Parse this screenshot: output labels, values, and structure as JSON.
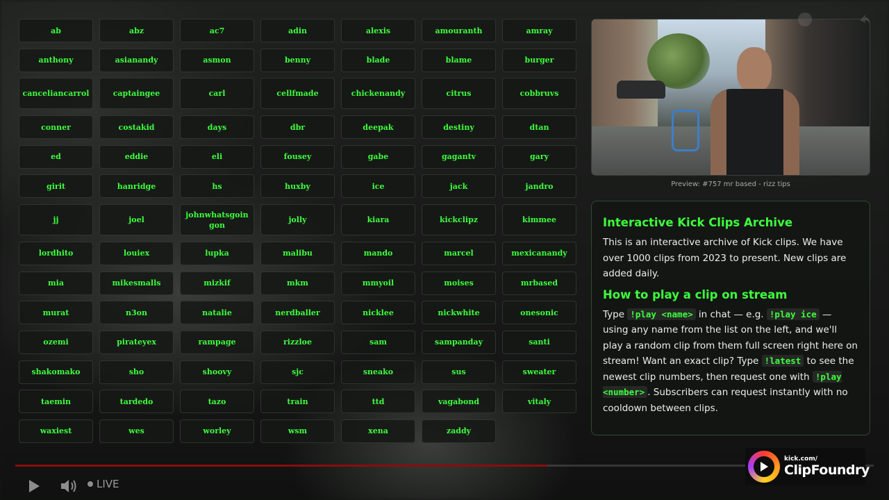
{
  "clip_names": [
    "ab",
    "abz",
    "ac7",
    "adin",
    "alexis",
    "amouranth",
    "amray",
    "anthony",
    "asianandy",
    "asmon",
    "benny",
    "blade",
    "blame",
    "burger",
    "canceliancarrol",
    "captaingee",
    "carl",
    "cellfmade",
    "chickenandy",
    "citrus",
    "cobbruvs",
    "conner",
    "costakid",
    "days",
    "dbr",
    "deepak",
    "destiny",
    "dtan",
    "ed",
    "eddie",
    "eli",
    "fousey",
    "gabe",
    "gagantv",
    "gary",
    "girit",
    "hanridge",
    "hs",
    "huxby",
    "ice",
    "jack",
    "jandro",
    "jj",
    "joel",
    "johnwhatsgoingon",
    "jolly",
    "kiara",
    "kickclipz",
    "kimmee",
    "lordhito",
    "louiex",
    "lupka",
    "malibu",
    "mando",
    "marcel",
    "mexicanandy",
    "mia",
    "mikesmalls",
    "mizkif",
    "mkm",
    "mmyoil",
    "moises",
    "mrbased",
    "murat",
    "n3on",
    "natalie",
    "nerdballer",
    "nicklee",
    "nickwhite",
    "onesonic",
    "ozemi",
    "pirateyex",
    "rampage",
    "rizzloe",
    "sam",
    "sampanday",
    "santi",
    "shakomako",
    "sho",
    "shoovy",
    "sjc",
    "sneako",
    "sus",
    "sweater",
    "taemin",
    "tardedo",
    "tazo",
    "train",
    "ttd",
    "vagabond",
    "vitaly",
    "waxiest",
    "wes",
    "worley",
    "wsm",
    "xena",
    "zaddy"
  ],
  "preview": {
    "caption": "Preview: #757 mr based - rizz tips"
  },
  "info": {
    "title": "Interactive Kick Clips Archive",
    "description": "This is an interactive archive of Kick clips. We have over 1000 clips from 2023 to present. New clips are added daily.",
    "howto_title": "How to play a clip on stream",
    "type_word": "Type ",
    "cmd_play_name": "!play <name>",
    "in_chat": " in chat — e.g. ",
    "cmd_play_ice": "!play ice",
    "howto_rest": " — using any name from the list on the left, and we'll play a random clip from them full screen right here on stream! Want an exact clip? Type ",
    "cmd_latest": "!latest",
    "latest_rest": " to see the newest clip numbers, then request one with ",
    "cmd_play_number": "!play <number>",
    "subscriber_text": ". Subscribers can request instantly with no cooldown between clips."
  },
  "player": {
    "live_label": "LIVE",
    "progress": 0.62
  },
  "logo": {
    "small": "kick.com/",
    "big": "ClipFoundry"
  },
  "colors": {
    "accent_green": "#3dff3d",
    "progress_red": "#8a0d0d"
  }
}
